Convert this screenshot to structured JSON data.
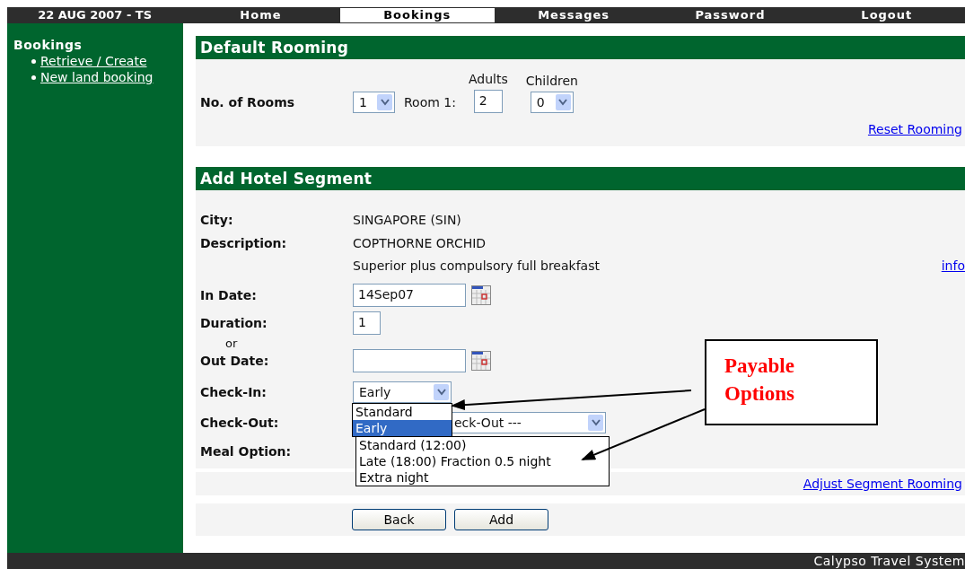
{
  "header": {
    "date": "22 AUG 2007 - TS",
    "tabs": [
      {
        "label": "Home",
        "selected": false
      },
      {
        "label": "Bookings",
        "selected": true
      },
      {
        "label": "Messages",
        "selected": false
      },
      {
        "label": "Password",
        "selected": false
      },
      {
        "label": "Logout",
        "selected": false
      }
    ]
  },
  "sidebar": {
    "title": "Bookings",
    "links": [
      "Retrieve / Create",
      "New land booking"
    ]
  },
  "default_rooming": {
    "title": "Default Rooming",
    "rooms_label": "No. of Rooms",
    "rooms_value": "1",
    "room_label": "Room 1:",
    "adults_label": "Adults",
    "adults_value": "2",
    "children_label": "Children",
    "children_value": "0",
    "reset_link": "Reset Rooming"
  },
  "hotel_segment": {
    "title": "Add Hotel Segment",
    "city_label": "City:",
    "city_value": "SINGAPORE (SIN)",
    "description_label": "Description:",
    "description_lines": [
      "COPTHORNE ORCHID",
      "Superior plus compulsory full breakfast"
    ],
    "info_link": "info",
    "in_date_label": "In Date:",
    "in_date_value": "14Sep07",
    "duration_label": "Duration:",
    "duration_value": "1",
    "or_text": "or",
    "out_date_label": "Out Date:",
    "check_in_label": "Check-In:",
    "check_in_value": "Early",
    "check_in_options": [
      {
        "label": "Standard",
        "selected": false
      },
      {
        "label": "Early",
        "selected": true
      }
    ],
    "check_out_label": "Check-Out:",
    "check_out_visible_text": "eck-Out ---",
    "check_out_options": [
      {
        "label": "Standard (12:00)",
        "selected": false
      },
      {
        "label": "Late (18:00) Fraction 0.5 night",
        "selected": false
      },
      {
        "label": "Extra night",
        "selected": false
      }
    ],
    "meal_label": "Meal Option:",
    "adjust_link": "Adjust Segment Rooming",
    "buttons": [
      "Back",
      "Add"
    ]
  },
  "callout": {
    "text": "Payable Options"
  },
  "footer": {
    "text": "Calypso Travel System"
  }
}
